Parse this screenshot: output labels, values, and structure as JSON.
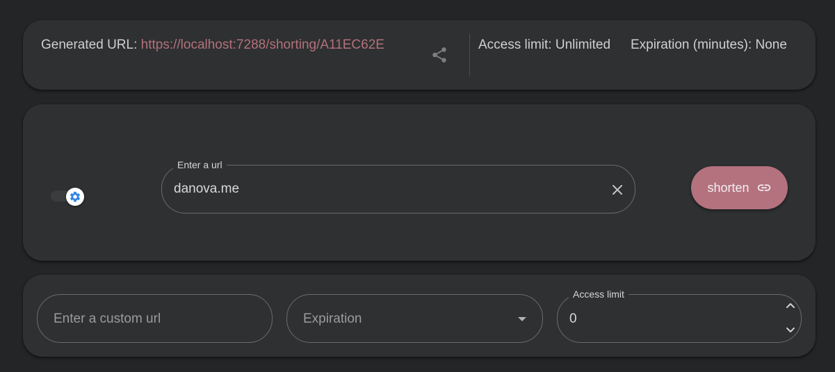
{
  "result": {
    "generated_label": "Generated URL:",
    "generated_url": "https://localhost:7288/shorting/A11EC62E",
    "share_icon": "share-icon",
    "access_limit_text": "Access limit: Unlimited",
    "expiration_text": "Expiration (minutes): None"
  },
  "input": {
    "settings_toggle_icon": "gear-icon",
    "url_label": "Enter a url",
    "url_value": "danova.me",
    "clear_icon": "close-icon",
    "shorten_label": "shorten",
    "shorten_icon": "link-icon"
  },
  "options": {
    "custom_url_placeholder": "Enter a custom url",
    "expiration_placeholder": "Expiration",
    "expiration_icon": "chevron-down-icon",
    "access_limit_label": "Access limit",
    "access_limit_value": "0",
    "spin_up_icon": "chevron-up-icon",
    "spin_down_icon": "chevron-down-icon"
  },
  "colors": {
    "background": "#242526",
    "card": "#2e3031",
    "accent": "#b3727e",
    "link": "#b4717d",
    "toggle_icon": "#2f86e6"
  }
}
